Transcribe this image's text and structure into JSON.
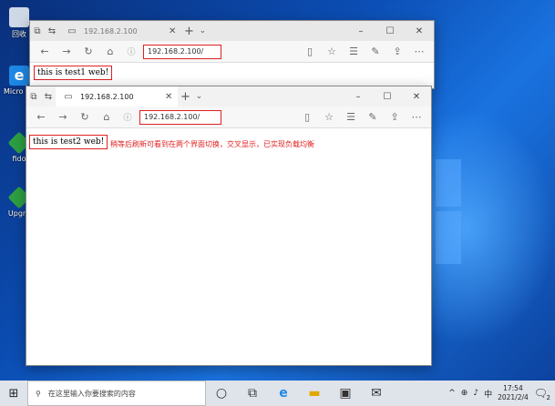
{
  "desktop": {
    "icons": [
      {
        "label": "回收",
        "icon": "recycle-bin-icon"
      },
      {
        "label": "Micro Edg",
        "icon": "edge-icon"
      },
      {
        "label": "fido",
        "icon": "app-icon"
      },
      {
        "label": "Upgra",
        "icon": "app-icon"
      }
    ]
  },
  "window_back": {
    "tab_title": "192.168.2.100",
    "address": "192.168.2.100/",
    "page_text": "this is test1 web!"
  },
  "window_front": {
    "tab_title": "192.168.2.100",
    "address": "192.168.2.100/",
    "page_text": "this is test2 web!",
    "annotation": "稍等后刷新可看到在两个界面切换，交叉显示，已实现负载均衡"
  },
  "taskbar": {
    "search_placeholder": "在这里输入你要搜索的内容",
    "ime": "中",
    "time": "17:54",
    "date": "2021/2/4",
    "notification_count": "2"
  },
  "colors": {
    "highlight": "#e02020",
    "desktop_blue": "#0b4db3"
  }
}
